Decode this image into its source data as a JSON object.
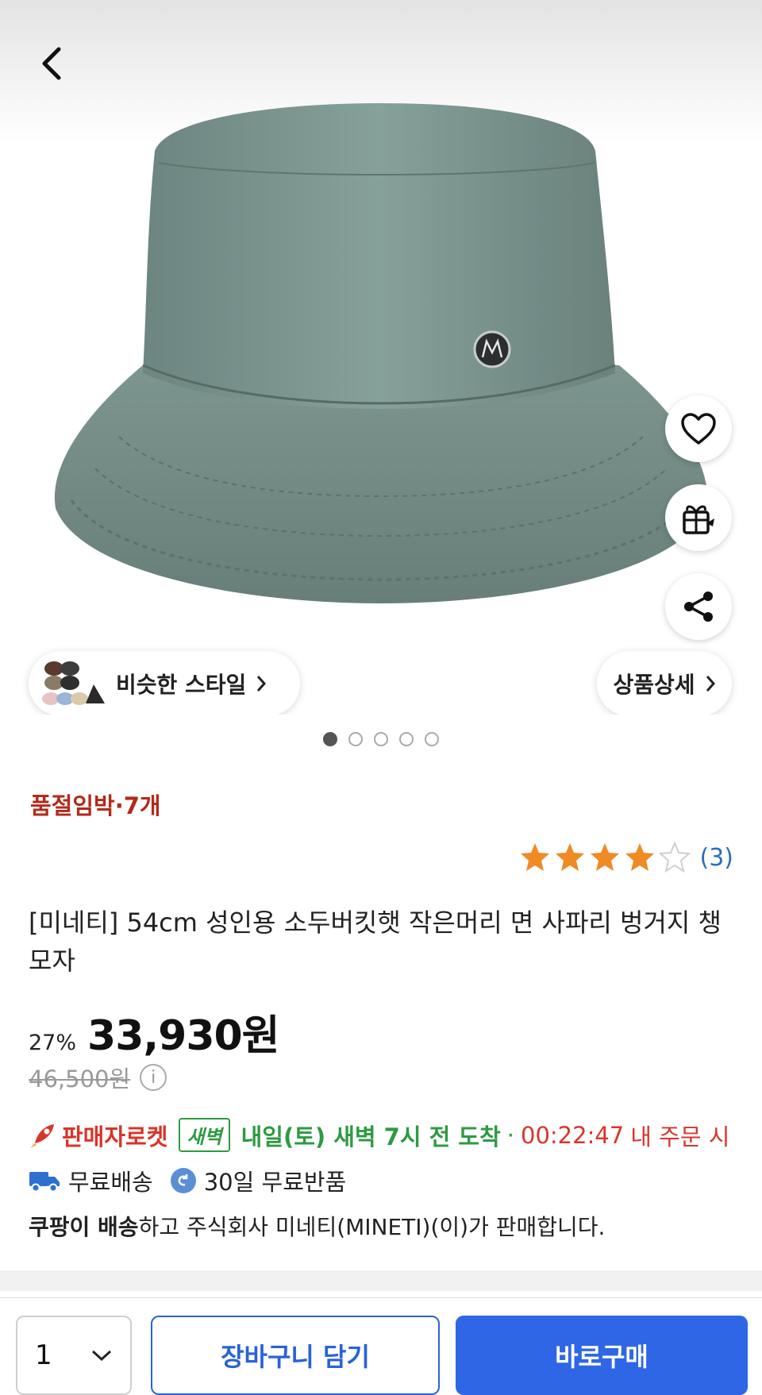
{
  "gallery": {
    "slide_count": 5,
    "active_slide": 1,
    "similar_style_label": "비슷한 스타일",
    "detail_label": "상품상세"
  },
  "icons": {
    "back": "chevron-left-icon",
    "wishlist": "heart-icon",
    "gift": "gift-icon",
    "share": "share-icon",
    "info": "info-icon",
    "rocket": "rocket-icon",
    "truck": "truck-icon",
    "return": "return-icon"
  },
  "product": {
    "stock_notice": "품절임박·7개",
    "rating_value": 4,
    "rating_max": 5,
    "review_count": "(3)",
    "title": "[미네티] 54cm 성인용 소두버킷햇 작은머리 면 사파리 벙거지 챙모자",
    "discount": "27%",
    "price": "33,930원",
    "original_price": "46,500원",
    "info_glyph": "i"
  },
  "delivery": {
    "rocket_label": "판매자로켓",
    "dawn_badge": "새벽",
    "arrival": "내일(토) 새벽 7시 전 도착",
    "separator": "·",
    "countdown": "00:22:47",
    "condition": "내 주문 시",
    "free_shipping": "무료배송",
    "free_return": "30일 무료반품"
  },
  "seller": {
    "bold_part": "쿠팡이 배송",
    "rest": "하고 주식회사 미네티(MINETI)(이)가 판매합니다."
  },
  "bottom_bar": {
    "quantity": "1",
    "cart_label": "장바구니 담기",
    "buy_label": "바로구매"
  },
  "colors": {
    "accent_blue": "#2e66e6",
    "warning_red": "#b22a1a",
    "rocket_red": "#d8352a",
    "dawn_green": "#2e9a42",
    "star_orange": "#f08a24",
    "hat_gray_green": "#7a918c"
  }
}
